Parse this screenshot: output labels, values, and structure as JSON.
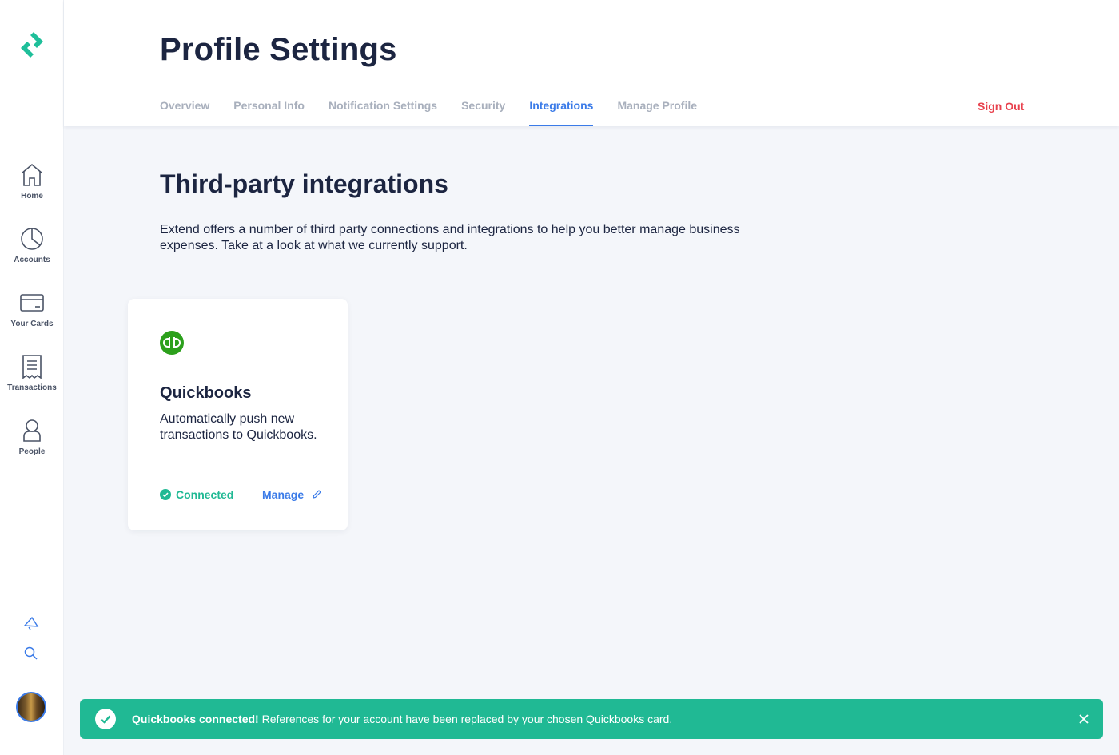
{
  "sidebar": {
    "items": [
      {
        "label": "Home",
        "icon": "home-icon"
      },
      {
        "label": "Accounts",
        "icon": "pie-chart-icon"
      },
      {
        "label": "Your Cards",
        "icon": "credit-card-icon"
      },
      {
        "label": "Transactions",
        "icon": "receipt-icon"
      },
      {
        "label": "People",
        "icon": "person-icon"
      }
    ],
    "tools": [
      "megaphone-icon",
      "search-icon"
    ]
  },
  "header": {
    "title": "Profile Settings",
    "tabs": [
      {
        "label": "Overview",
        "active": false
      },
      {
        "label": "Personal Info",
        "active": false
      },
      {
        "label": "Notification Settings",
        "active": false
      },
      {
        "label": "Security",
        "active": false
      },
      {
        "label": "Integrations",
        "active": true
      },
      {
        "label": "Manage Profile",
        "active": false
      }
    ],
    "sign_out": "Sign Out"
  },
  "main": {
    "title": "Third-party integrations",
    "description": "Extend offers a number of third party connections and integrations to help you better manage business expenses. Take at a look at what we currently support.",
    "integrations": [
      {
        "name": "Quickbooks",
        "description": "Automatically push new transactions to Quickbooks.",
        "status": "Connected",
        "action": "Manage"
      }
    ]
  },
  "toast": {
    "bold": "Quickbooks connected!",
    "message": " References for your account have been replaced by your chosen Quickbooks card."
  },
  "colors": {
    "accent": "#3b7be8",
    "success": "#20b994",
    "danger": "#e8414d",
    "heading": "#1c2541",
    "quickbooks": "#2ca01c"
  }
}
